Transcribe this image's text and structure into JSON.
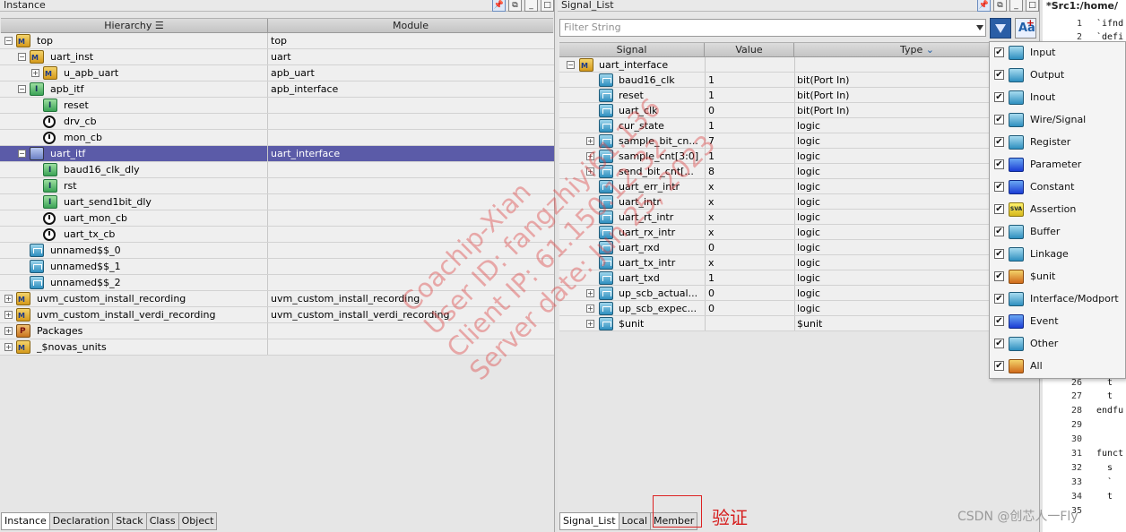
{
  "instance_panel": {
    "title": "Instance",
    "headers": {
      "hierarchy": "Hierarchy",
      "module": "Module"
    },
    "rows": [
      {
        "name": "top",
        "module": "top",
        "exp": "−",
        "icon": "module",
        "indent": 0
      },
      {
        "name": "uart_inst",
        "module": "uart",
        "exp": "−",
        "icon": "module",
        "indent": 1
      },
      {
        "name": "u_apb_uart",
        "module": "apb_uart",
        "exp": "+",
        "icon": "module",
        "indent": 2
      },
      {
        "name": "apb_itf",
        "module": "apb_interface",
        "exp": "−",
        "icon": "interface",
        "indent": 1
      },
      {
        "name": "reset",
        "module": "",
        "exp": "",
        "icon": "interface",
        "indent": 2
      },
      {
        "name": "drv_cb",
        "module": "",
        "exp": "",
        "icon": "clock",
        "indent": 2
      },
      {
        "name": "mon_cb",
        "module": "",
        "exp": "",
        "icon": "clock",
        "indent": 2
      },
      {
        "name": "uart_itf",
        "module": "uart_interface",
        "exp": "−",
        "icon": "selected",
        "indent": 1,
        "selected": true
      },
      {
        "name": "baud16_clk_dly",
        "module": "",
        "exp": "",
        "icon": "interface",
        "indent": 2
      },
      {
        "name": "rst",
        "module": "",
        "exp": "",
        "icon": "interface",
        "indent": 2
      },
      {
        "name": "uart_send1bit_dly",
        "module": "",
        "exp": "",
        "icon": "interface",
        "indent": 2
      },
      {
        "name": "uart_mon_cb",
        "module": "",
        "exp": "",
        "icon": "clock",
        "indent": 2
      },
      {
        "name": "uart_tx_cb",
        "module": "",
        "exp": "",
        "icon": "clock",
        "indent": 2
      },
      {
        "name": "unnamed$$_0",
        "module": "",
        "exp": "",
        "icon": "signal",
        "indent": 1
      },
      {
        "name": "unnamed$$_1",
        "module": "",
        "exp": "",
        "icon": "signal",
        "indent": 1
      },
      {
        "name": "unnamed$$_2",
        "module": "",
        "exp": "",
        "icon": "signal",
        "indent": 1
      },
      {
        "name": "uvm_custom_install_recording",
        "module": "uvm_custom_install_recording",
        "exp": "+",
        "icon": "module",
        "indent": 0
      },
      {
        "name": "uvm_custom_install_verdi_recording",
        "module": "uvm_custom_install_verdi_recording",
        "exp": "+",
        "icon": "module",
        "indent": 0
      },
      {
        "name": "Packages",
        "module": "",
        "exp": "+",
        "icon": "package",
        "indent": 0
      },
      {
        "name": "_$novas_units",
        "module": "",
        "exp": "+",
        "icon": "module",
        "indent": 0
      }
    ],
    "tabs": [
      "Instance",
      "Declaration",
      "Stack",
      "Class",
      "Object"
    ],
    "active_tab": "Instance"
  },
  "signal_panel": {
    "title": "Signal_List",
    "filter_placeholder": "Filter String",
    "headers": {
      "signal": "Signal",
      "value": "Value",
      "type": "Type"
    },
    "rows": [
      {
        "name": "uart_interface",
        "value": "",
        "type": "",
        "exp": "−",
        "group": true
      },
      {
        "name": "baud16_clk",
        "value": "1",
        "type": "bit(Port In)",
        "exp": ""
      },
      {
        "name": "reset",
        "value": "1",
        "type": "bit(Port In)",
        "exp": ""
      },
      {
        "name": "uart_clk",
        "value": "0",
        "type": "bit(Port In)",
        "exp": ""
      },
      {
        "name": "cur_state",
        "value": "1",
        "type": "logic",
        "exp": ""
      },
      {
        "name": "sample_bit_cn...",
        "value": "7",
        "type": "logic",
        "exp": "+"
      },
      {
        "name": "sample_cnt[3:0]",
        "value": "1",
        "type": "logic",
        "exp": "+"
      },
      {
        "name": "send_bit_cnt[...",
        "value": "8",
        "type": "logic",
        "exp": "+"
      },
      {
        "name": "uart_err_intr",
        "value": "x",
        "type": "logic",
        "exp": ""
      },
      {
        "name": "uart_intr",
        "value": "x",
        "type": "logic",
        "exp": ""
      },
      {
        "name": "uart_rt_intr",
        "value": "x",
        "type": "logic",
        "exp": ""
      },
      {
        "name": "uart_rx_intr",
        "value": "x",
        "type": "logic",
        "exp": ""
      },
      {
        "name": "uart_rxd",
        "value": "0",
        "type": "logic",
        "exp": ""
      },
      {
        "name": "uart_tx_intr",
        "value": "x",
        "type": "logic",
        "exp": ""
      },
      {
        "name": "uart_txd",
        "value": "1",
        "type": "logic",
        "exp": ""
      },
      {
        "name": "up_scb_actual...",
        "value": "0",
        "type": "logic",
        "exp": "+"
      },
      {
        "name": "up_scb_expec...",
        "value": "0",
        "type": "logic",
        "exp": "+"
      },
      {
        "name": "$unit",
        "value": "",
        "type": "$unit",
        "exp": "+"
      }
    ],
    "tabs": [
      "Signal_List",
      "Local",
      "Member"
    ],
    "active_tab": "Signal_List"
  },
  "type_menu": {
    "items": [
      {
        "label": "Input",
        "checked": "✔",
        "icon": "input-icon"
      },
      {
        "label": "Output",
        "checked": "✔",
        "icon": "output-icon"
      },
      {
        "label": "Inout",
        "checked": "✔",
        "icon": "inout-icon"
      },
      {
        "label": "Wire/Signal",
        "checked": "✔",
        "icon": "wire-icon"
      },
      {
        "label": "Register",
        "checked": "✔",
        "icon": "register-icon"
      },
      {
        "label": "Parameter",
        "checked": "✔",
        "icon": "parameter-icon"
      },
      {
        "label": "Constant",
        "checked": "✔",
        "icon": "constant-icon"
      },
      {
        "label": "Assertion",
        "checked": "✔",
        "icon": "assertion-icon"
      },
      {
        "label": "Buffer",
        "checked": "✔",
        "icon": "buffer-icon"
      },
      {
        "label": "Linkage",
        "checked": "✔",
        "icon": "linkage-icon"
      },
      {
        "label": "$unit",
        "checked": "✔",
        "icon": "unit-icon"
      },
      {
        "label": "Interface/Modport",
        "checked": "✔",
        "icon": "interface-modport-icon"
      },
      {
        "label": "Event",
        "checked": "✔",
        "icon": "event-icon"
      },
      {
        "label": "Other",
        "checked": "✔",
        "icon": "other-icon"
      },
      {
        "label": "All",
        "checked": "✔",
        "icon": "all-icon"
      }
    ]
  },
  "src_panel": {
    "title": "*Src1:/home/",
    "lines": [
      {
        "num": "1",
        "text": "`ifnd"
      },
      {
        "num": "2",
        "text": "`defi"
      },
      {
        "num": "26",
        "text": "  t"
      },
      {
        "num": "27",
        "text": "  t"
      },
      {
        "num": "28",
        "text": "endfu"
      },
      {
        "num": "29",
        "text": ""
      },
      {
        "num": "30",
        "text": ""
      },
      {
        "num": "31",
        "text": "funct"
      },
      {
        "num": "32",
        "text": "  s"
      },
      {
        "num": "33",
        "text": "  `"
      },
      {
        "num": "34",
        "text": "  t"
      },
      {
        "num": "35",
        "text": ""
      }
    ]
  },
  "annotation": {
    "text": "验证"
  },
  "watermark": {
    "lines": [
      "Coachip-Xian",
      "User ID: fangzhiyi61.136",
      "Client IP: 61.150.12.32",
      "Server date: Jun 25, 2023"
    ]
  },
  "csdn_credit": "CSDN @创芯人一Fly",
  "colors": {
    "selection": "#5b5ba8",
    "annotation_red": "#d61e1e",
    "funnel_blue": "#2a5ea6"
  }
}
